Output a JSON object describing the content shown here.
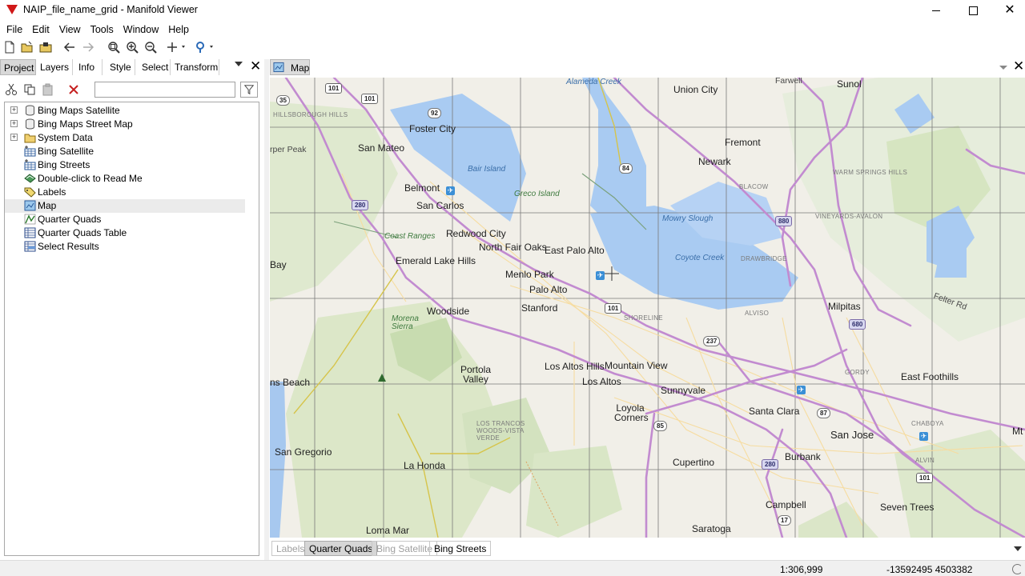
{
  "window": {
    "title": "NAIP_file_name_grid - Manifold Viewer",
    "controls": {
      "minimize": "—",
      "maximize": "☐",
      "close": "✕"
    }
  },
  "menu": [
    "File",
    "Edit",
    "View",
    "Tools",
    "Window",
    "Help"
  ],
  "toolbar": {
    "icons": [
      "new-icon",
      "open-icon",
      "save-icon",
      "back-icon",
      "forward-icon",
      "zoom-fit-icon",
      "zoom-in-icon",
      "zoom-out-icon",
      "add-component-icon",
      "locate-icon"
    ]
  },
  "left_panel": {
    "tabs": [
      "Project",
      "Layers",
      "Info",
      "Style",
      "Select",
      "Transform"
    ],
    "active_tab": "Project",
    "filter": {
      "value": "",
      "placeholder": ""
    },
    "tree": [
      {
        "label": "Bing Maps Satellite",
        "icon": "data-source-icon",
        "expandable": true
      },
      {
        "label": "Bing Maps Street Map",
        "icon": "data-source-icon",
        "expandable": true
      },
      {
        "label": "System Data",
        "icon": "folder-icon",
        "expandable": true
      },
      {
        "label": "Bing Satellite",
        "icon": "image-icon",
        "expandable": false
      },
      {
        "label": "Bing Streets",
        "icon": "image-icon",
        "expandable": false
      },
      {
        "label": "Double-click to Read Me",
        "icon": "comments-icon",
        "expandable": false
      },
      {
        "label": "Labels",
        "icon": "labels-icon",
        "expandable": false
      },
      {
        "label": "Map",
        "icon": "map-icon",
        "expandable": false,
        "selected": true
      },
      {
        "label": "Quarter Quads",
        "icon": "drawing-icon",
        "expandable": false
      },
      {
        "label": "Quarter Quads Table",
        "icon": "table-icon",
        "expandable": false
      },
      {
        "label": "Select Results",
        "icon": "query-icon",
        "expandable": false
      }
    ]
  },
  "map_window": {
    "tab_label": "Map",
    "place_labels": {
      "union_city": "Union City",
      "sunol": "Sunol",
      "fremont": "Fremont",
      "newark": "Newark",
      "foster_city": "Foster City",
      "san_mateo": "San Mateo",
      "belmont": "Belmont",
      "san_carlos": "San Carlos",
      "redwood_city": "Redwood City",
      "east_palo_alto": "East Palo Alto",
      "north_fair_oaks": "North Fair Oaks",
      "emerald_lake_hills": "Emerald Lake Hills",
      "menlo_park": "Menlo Park",
      "palo_alto": "Palo Alto",
      "stanford": "Stanford",
      "woodside": "Woodside",
      "milpitas": "Milpitas",
      "mountain_view": "Mountain View",
      "los_altos_hills": "Los Altos Hills",
      "los_altos": "Los Altos",
      "portola_valley": "Portola Valley",
      "sunnyvale": "Sunnyvale",
      "santa_clara": "Santa Clara",
      "east_foothills": "East Foothills",
      "san_jose": "San Jose",
      "loyola_corners": "Loyola Corners",
      "san_gregorio": "San Gregorio",
      "la_honda": "La Honda",
      "cupertino": "Cupertino",
      "burbank": "Burbank",
      "campbell": "Campbell",
      "seven_trees": "Seven Trees",
      "loma_mar": "Loma Mar",
      "saratoga": "Saratoga",
      "farwell": "Farwell",
      "bay": "Bay",
      "ns_beach": "ns Beach",
      "mt": "Mt",
      "per_peak": "rper Peak",
      "bair_island": "Bair Island",
      "greco_island": "Greco Island",
      "mowry_slough": "Mowry Slough",
      "coyote_creek": "Coyote Creek",
      "alameda_creek": "Alameda Creek",
      "coast_ranges": "Coast Ranges",
      "morena_sierra": "Morena Sierra",
      "hillsborough_hills": "HILLSBOROUGH HILLS",
      "warm_springs_hills": "WARM SPRINGS HILLS",
      "blacow": "BLACOW",
      "vineyards_avalon": "VINEYARDS-AVALON",
      "drawbridge": "DRAWBRIDGE",
      "shoreline": "SHORELINE",
      "alviso": "ALVISO",
      "gordy": "GORDY",
      "los_trancos": "LOS TRANCOS WOODS-VISTA VERDE",
      "alvin": "ALVIN",
      "chaboya": "CHABOYA",
      "felter_rd": "Felter Rd"
    },
    "shields": [
      "35",
      "101",
      "101",
      "92",
      "84",
      "280",
      "880",
      "101",
      "237",
      "680",
      "85",
      "87",
      "280",
      "17",
      "101"
    ]
  },
  "layer_tabs": [
    {
      "label": "Labels",
      "state": "dim"
    },
    {
      "label": "Quarter Quads",
      "state": "active"
    },
    {
      "label": "Bing Satellite",
      "state": "dim"
    },
    {
      "label": "Bing Streets",
      "state": "normal"
    }
  ],
  "status": {
    "scale": "1:306,999",
    "coordinates": "-13592495 4503382"
  }
}
